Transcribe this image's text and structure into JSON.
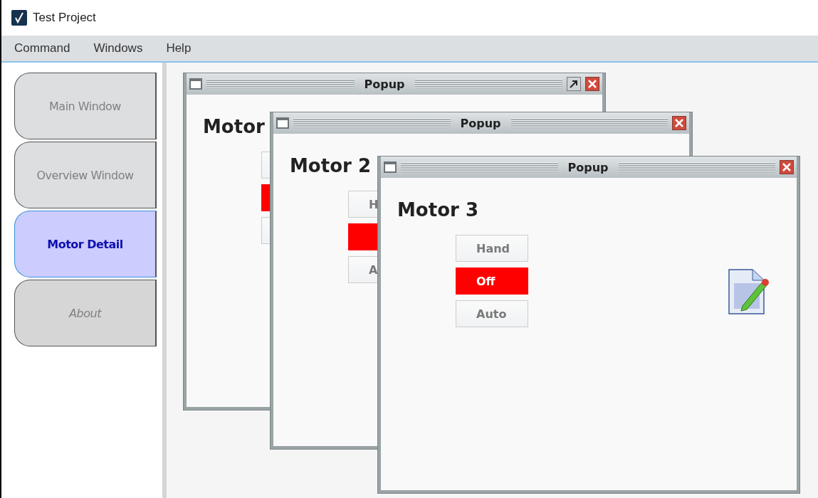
{
  "window": {
    "title": "Test Project"
  },
  "menu": [
    "Command",
    "Windows",
    "Help"
  ],
  "tabs": [
    {
      "label": "Main Window",
      "selected": false,
      "disabled": false
    },
    {
      "label": "Overview Window",
      "selected": false,
      "disabled": false
    },
    {
      "label": "Motor Detail",
      "selected": true,
      "disabled": false
    },
    {
      "label": "About",
      "selected": false,
      "disabled": true
    }
  ],
  "popups": [
    {
      "title": "Popup",
      "heading": "Motor",
      "buttons": [
        {
          "selected": false
        },
        {
          "selected": true
        },
        {
          "selected": false
        }
      ]
    },
    {
      "title": "Popup",
      "heading": "Motor 2",
      "buttons": [
        {
          "label": "H",
          "selected": false
        },
        {
          "selected": true
        },
        {
          "label": "A",
          "selected": false
        }
      ]
    },
    {
      "title": "Popup",
      "heading": "Motor 3",
      "buttons": [
        {
          "label": "Hand",
          "selected": false
        },
        {
          "label": "Off",
          "selected": true
        },
        {
          "label": "Auto",
          "selected": false
        }
      ]
    }
  ]
}
